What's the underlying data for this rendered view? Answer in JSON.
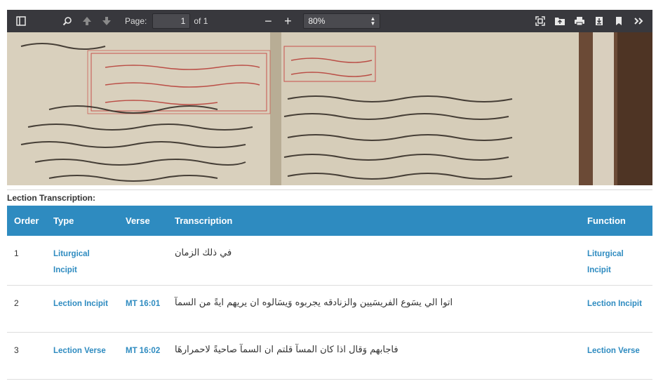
{
  "toolbar": {
    "page_label": "Page:",
    "page_value": "1",
    "page_of": "of 1",
    "zoom_value": "80%",
    "minus": "−",
    "plus": "+"
  },
  "section": {
    "title": "Lection Transcription:"
  },
  "table": {
    "headers": {
      "order": "Order",
      "type": "Type",
      "verse": "Verse",
      "transcription": "Transcription",
      "function": "Function"
    },
    "rows": [
      {
        "order": "1",
        "type": "Liturgical Incipit",
        "verse": "",
        "transcription": "في ذلك الزمان",
        "function": "Liturgical Incipit"
      },
      {
        "order": "2",
        "type": "Lection Incipit",
        "verse": "MT 16:01",
        "transcription": "اتوا الي يسَوع الفريسَيين  والزنادقه يجربوه وَيسَالوه ان يريهم ايةً من السمآ",
        "function": "Lection Incipit"
      },
      {
        "order": "3",
        "type": "Lection Verse",
        "verse": "MT 16:02",
        "transcription": "فاجابهم وَقال اذا كان المسآ قلتم ان السمآ صاحيةً لاحمرارهَا",
        "function": "Lection Verse"
      }
    ]
  }
}
